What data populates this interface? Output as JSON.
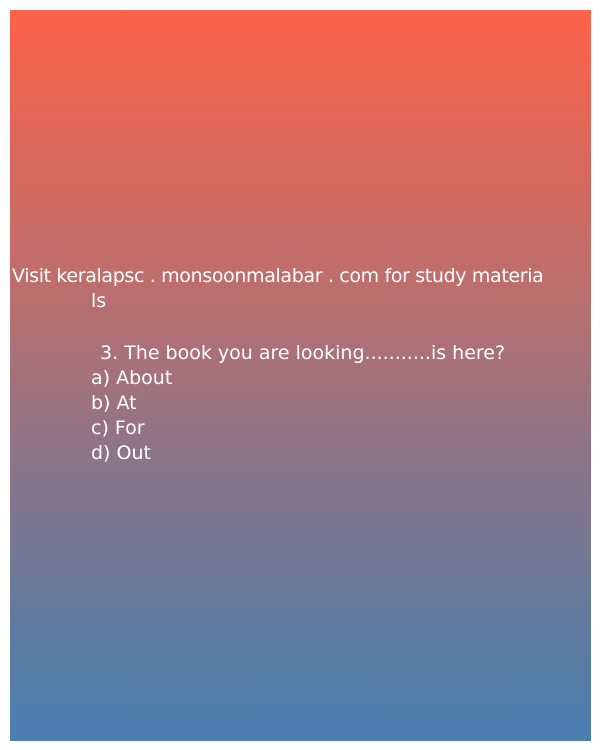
{
  "promo": {
    "line1": "Visit keralapsc . monsoonmalabar . com for study materia",
    "line2": "ls"
  },
  "question": {
    "text": "3. The book you are looking...........is here?",
    "options": [
      "a) About",
      "b) At",
      "c) For",
      "d) Out"
    ]
  },
  "colors": {
    "gradient_top": "#fd624a",
    "gradient_bottom": "#4a7fb1",
    "text": "#ffffff",
    "border": "#ffffff"
  }
}
